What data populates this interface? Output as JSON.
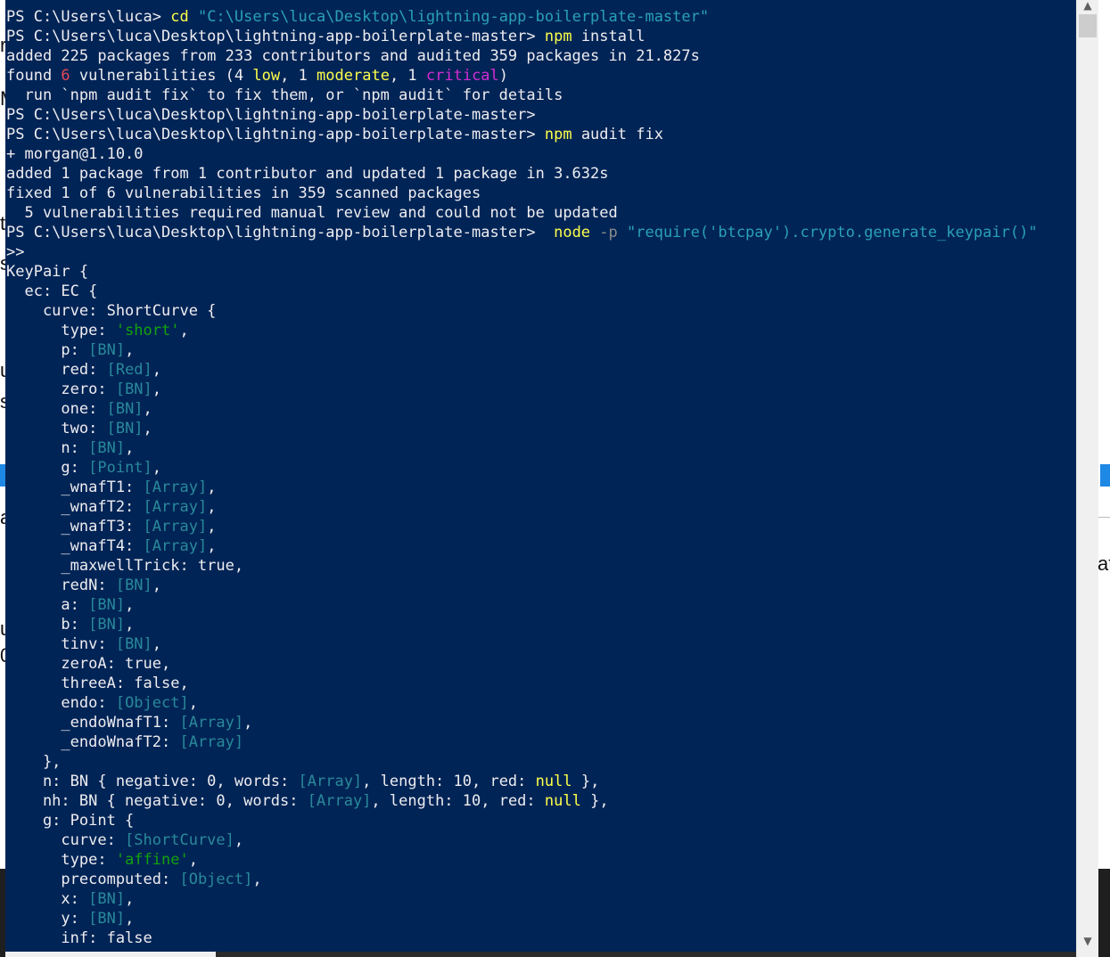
{
  "colors": {
    "terminal_bg": "#012456",
    "text": "#eeedf0",
    "command": "#ffff4a",
    "string": "#2aa1b3",
    "reference": "#29899a",
    "literal_string": "#13a10e",
    "low_count": "#e74856",
    "critical": "#d42cd3",
    "parameter": "#8b8b8b"
  },
  "terminal": {
    "lines": [
      [
        {
          "t": "PS C:\\Users\\luca> ",
          "c": "white"
        },
        {
          "t": "cd ",
          "c": "yellow"
        },
        {
          "t": "\"C:\\Users\\luca\\Desktop\\lightning-app-boilerplate-master\"",
          "c": "teal"
        }
      ],
      [
        {
          "t": "PS C:\\Users\\luca\\Desktop\\lightning-app-boilerplate-master> ",
          "c": "white"
        },
        {
          "t": "npm ",
          "c": "yellow"
        },
        {
          "t": "install",
          "c": "white"
        }
      ],
      [
        {
          "t": "added 225 packages from 233 contributors and audited 359 packages in 21.827s",
          "c": "white"
        }
      ],
      [
        {
          "t": "found ",
          "c": "white"
        },
        {
          "t": "6",
          "c": "red"
        },
        {
          "t": " vulnerabilities (4 ",
          "c": "white"
        },
        {
          "t": "low",
          "c": "yellow"
        },
        {
          "t": ", 1 ",
          "c": "white"
        },
        {
          "t": "moderate",
          "c": "yellow"
        },
        {
          "t": ", 1 ",
          "c": "white"
        },
        {
          "t": "critical",
          "c": "magenta"
        },
        {
          "t": ")",
          "c": "white"
        }
      ],
      [
        {
          "t": "  run `npm audit fix` to fix them, or `npm audit` for details",
          "c": "white"
        }
      ],
      [
        {
          "t": "PS C:\\Users\\luca\\Desktop\\lightning-app-boilerplate-master>",
          "c": "white"
        }
      ],
      [
        {
          "t": "PS C:\\Users\\luca\\Desktop\\lightning-app-boilerplate-master> ",
          "c": "white"
        },
        {
          "t": "npm ",
          "c": "yellow"
        },
        {
          "t": "audit fix",
          "c": "white"
        }
      ],
      [
        {
          "t": "+ morgan@1.10.0",
          "c": "white"
        }
      ],
      [
        {
          "t": "added 1 package from 1 contributor and updated 1 package in 3.632s",
          "c": "white"
        }
      ],
      [
        {
          "t": "fixed 1 of 6 vulnerabilities in 359 scanned packages",
          "c": "white"
        }
      ],
      [
        {
          "t": "  5 vulnerabilities required manual review and could not be updated",
          "c": "white"
        }
      ],
      [
        {
          "t": "PS C:\\Users\\luca\\Desktop\\lightning-app-boilerplate-master>  ",
          "c": "white"
        },
        {
          "t": "node ",
          "c": "yellow"
        },
        {
          "t": "-p ",
          "c": "gray"
        },
        {
          "t": "\"require('btcpay').crypto.generate_keypair()\"",
          "c": "teal"
        }
      ],
      [
        {
          "t": ">>",
          "c": "white"
        }
      ],
      [
        {
          "t": "KeyPair {",
          "c": "white"
        }
      ],
      [
        {
          "t": "  ec: EC {",
          "c": "white"
        }
      ],
      [
        {
          "t": "    curve: ShortCurve {",
          "c": "white"
        }
      ],
      [
        {
          "t": "      type: ",
          "c": "white"
        },
        {
          "t": "'short'",
          "c": "green"
        },
        {
          "t": ",",
          "c": "white"
        }
      ],
      [
        {
          "t": "      p: ",
          "c": "white"
        },
        {
          "t": "[BN]",
          "c": "ref"
        },
        {
          "t": ",",
          "c": "white"
        }
      ],
      [
        {
          "t": "      red: ",
          "c": "white"
        },
        {
          "t": "[Red]",
          "c": "ref"
        },
        {
          "t": ",",
          "c": "white"
        }
      ],
      [
        {
          "t": "      zero: ",
          "c": "white"
        },
        {
          "t": "[BN]",
          "c": "ref"
        },
        {
          "t": ",",
          "c": "white"
        }
      ],
      [
        {
          "t": "      one: ",
          "c": "white"
        },
        {
          "t": "[BN]",
          "c": "ref"
        },
        {
          "t": ",",
          "c": "white"
        }
      ],
      [
        {
          "t": "      two: ",
          "c": "white"
        },
        {
          "t": "[BN]",
          "c": "ref"
        },
        {
          "t": ",",
          "c": "white"
        }
      ],
      [
        {
          "t": "      n: ",
          "c": "white"
        },
        {
          "t": "[BN]",
          "c": "ref"
        },
        {
          "t": ",",
          "c": "white"
        }
      ],
      [
        {
          "t": "      g: ",
          "c": "white"
        },
        {
          "t": "[Point]",
          "c": "ref"
        },
        {
          "t": ",",
          "c": "white"
        }
      ],
      [
        {
          "t": "      _wnafT1: ",
          "c": "white"
        },
        {
          "t": "[Array]",
          "c": "ref"
        },
        {
          "t": ",",
          "c": "white"
        }
      ],
      [
        {
          "t": "      _wnafT2: ",
          "c": "white"
        },
        {
          "t": "[Array]",
          "c": "ref"
        },
        {
          "t": ",",
          "c": "white"
        }
      ],
      [
        {
          "t": "      _wnafT3: ",
          "c": "white"
        },
        {
          "t": "[Array]",
          "c": "ref"
        },
        {
          "t": ",",
          "c": "white"
        }
      ],
      [
        {
          "t": "      _wnafT4: ",
          "c": "white"
        },
        {
          "t": "[Array]",
          "c": "ref"
        },
        {
          "t": ",",
          "c": "white"
        }
      ],
      [
        {
          "t": "      _maxwellTrick: true,",
          "c": "white"
        }
      ],
      [
        {
          "t": "      redN: ",
          "c": "white"
        },
        {
          "t": "[BN]",
          "c": "ref"
        },
        {
          "t": ",",
          "c": "white"
        }
      ],
      [
        {
          "t": "      a: ",
          "c": "white"
        },
        {
          "t": "[BN]",
          "c": "ref"
        },
        {
          "t": ",",
          "c": "white"
        }
      ],
      [
        {
          "t": "      b: ",
          "c": "white"
        },
        {
          "t": "[BN]",
          "c": "ref"
        },
        {
          "t": ",",
          "c": "white"
        }
      ],
      [
        {
          "t": "      tinv: ",
          "c": "white"
        },
        {
          "t": "[BN]",
          "c": "ref"
        },
        {
          "t": ",",
          "c": "white"
        }
      ],
      [
        {
          "t": "      zeroA: true,",
          "c": "white"
        }
      ],
      [
        {
          "t": "      threeA: false,",
          "c": "white"
        }
      ],
      [
        {
          "t": "      endo: ",
          "c": "white"
        },
        {
          "t": "[Object]",
          "c": "ref"
        },
        {
          "t": ",",
          "c": "white"
        }
      ],
      [
        {
          "t": "      _endoWnafT1: ",
          "c": "white"
        },
        {
          "t": "[Array]",
          "c": "ref"
        },
        {
          "t": ",",
          "c": "white"
        }
      ],
      [
        {
          "t": "      _endoWnafT2: ",
          "c": "white"
        },
        {
          "t": "[Array]",
          "c": "ref"
        }
      ],
      [
        {
          "t": "    },",
          "c": "white"
        }
      ],
      [
        {
          "t": "    n: BN { negative: 0, words: ",
          "c": "white"
        },
        {
          "t": "[Array]",
          "c": "ref"
        },
        {
          "t": ", length: 10, red: ",
          "c": "white"
        },
        {
          "t": "null",
          "c": "yellow"
        },
        {
          "t": " },",
          "c": "white"
        }
      ],
      [
        {
          "t": "    nh: BN { negative: 0, words: ",
          "c": "white"
        },
        {
          "t": "[Array]",
          "c": "ref"
        },
        {
          "t": ", length: 10, red: ",
          "c": "white"
        },
        {
          "t": "null",
          "c": "yellow"
        },
        {
          "t": " },",
          "c": "white"
        }
      ],
      [
        {
          "t": "    g: Point {",
          "c": "white"
        }
      ],
      [
        {
          "t": "      curve: ",
          "c": "white"
        },
        {
          "t": "[ShortCurve]",
          "c": "ref"
        },
        {
          "t": ",",
          "c": "white"
        }
      ],
      [
        {
          "t": "      type: ",
          "c": "white"
        },
        {
          "t": "'affine'",
          "c": "green"
        },
        {
          "t": ",",
          "c": "white"
        }
      ],
      [
        {
          "t": "      precomputed: ",
          "c": "white"
        },
        {
          "t": "[Object]",
          "c": "ref"
        },
        {
          "t": ",",
          "c": "white"
        }
      ],
      [
        {
          "t": "      x: ",
          "c": "white"
        },
        {
          "t": "[BN]",
          "c": "ref"
        },
        {
          "t": ",",
          "c": "white"
        }
      ],
      [
        {
          "t": "      y: ",
          "c": "white"
        },
        {
          "t": "[BN]",
          "c": "ref"
        },
        {
          "t": ",",
          "c": "white"
        }
      ],
      [
        {
          "t": "      inf: false",
          "c": "white"
        }
      ]
    ]
  },
  "scrollbar": {
    "up_icon": "▲",
    "down_icon": "▼"
  },
  "background": {
    "left_fragments": [
      "r",
      "M",
      "t",
      "s",
      "u",
      "s",
      "a",
      "u",
      "0"
    ],
    "right_fragment": "at"
  }
}
